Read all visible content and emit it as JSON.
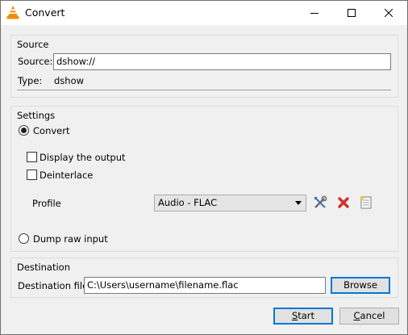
{
  "window": {
    "title": "Convert",
    "icon": "vlc-cone-icon",
    "controls": [
      "minimize-icon",
      "maximize-icon",
      "close-icon"
    ]
  },
  "source": {
    "group_title": "Source",
    "source_label": "Source:",
    "source_value": "dshow://",
    "type_label": "Type:",
    "type_value": "dshow"
  },
  "settings": {
    "group_title": "Settings",
    "convert_label": "Convert",
    "convert_checked": true,
    "display_output_label": "Display the output",
    "display_output_checked": false,
    "deinterlace_label": "Deinterlace",
    "deinterlace_checked": false,
    "profile_label": "Profile",
    "profile_value": "Audio - FLAC",
    "profile_tools": [
      "edit-profile-icon",
      "delete-profile-icon",
      "new-profile-icon"
    ],
    "dump_raw_label": "Dump raw input",
    "dump_raw_checked": false
  },
  "destination": {
    "group_title": "Destination",
    "file_label": "Destination file:",
    "file_value": "C:\\Users\\username\\filename.flac",
    "browse_label": "Browse"
  },
  "footer": {
    "start_first": "S",
    "start_rest": "tart",
    "cancel_first": "C",
    "cancel_rest": "ancel"
  },
  "colors": {
    "accent": "#0078d7",
    "background": "#f0f0f0",
    "delete_red": "#d32f2f",
    "vlc_orange": "#f28b00"
  }
}
